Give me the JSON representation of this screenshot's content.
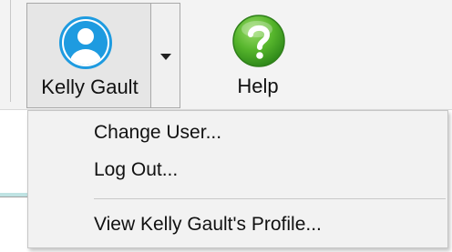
{
  "ribbon": {
    "user_button": {
      "label": "Kelly Gault",
      "icon": "user-avatar-icon",
      "icon_color": "#1e9be0"
    },
    "dropdown_arrow_icon": "chevron-down-icon",
    "help_button": {
      "label": "Help",
      "icon": "help-question-icon",
      "icon_color": "#4cae2f"
    }
  },
  "user_menu": {
    "items": [
      {
        "label": "Change User..."
      },
      {
        "label": "Log Out..."
      },
      {
        "label": "View Kelly Gault's Profile..."
      }
    ]
  }
}
